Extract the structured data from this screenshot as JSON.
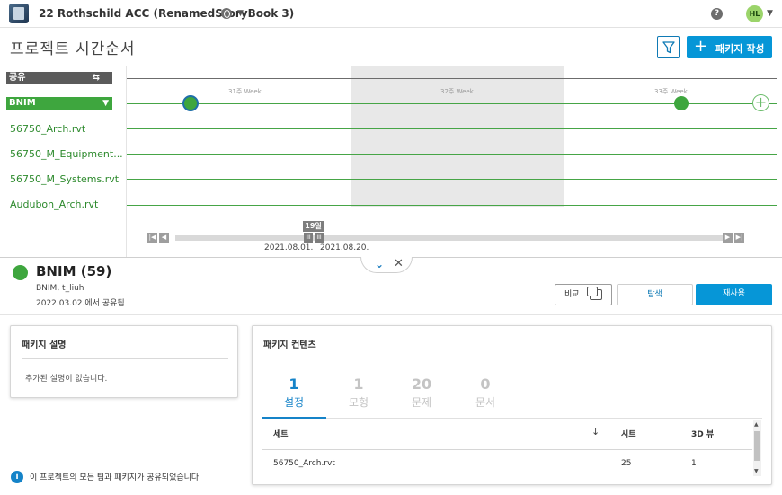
{
  "topbar": {
    "project_title": "22 Rothschild ACC (RenamedStoryBook 3)",
    "help_label": "?",
    "avatar_initials": "HL"
  },
  "header": {
    "page_title": "프로젝트 시간순서",
    "create_label": "패키지 작성",
    "create_plus": "+"
  },
  "sidebar": {
    "shared_label": "공유",
    "swap_glyph": "⇆",
    "group_label": "BNIM",
    "group_caret": "▼",
    "files": [
      "56750_Arch.rvt",
      "56750_M_Equipment...",
      "56750_M_Systems.rvt",
      "Audubon_Arch.rvt"
    ]
  },
  "timeline": {
    "weeks": [
      "31주 Week",
      "32주 Week",
      "33주 Week"
    ],
    "date_tag": "19일",
    "start_date": "2021.08.01.",
    "end_date": "2021.08.20.",
    "add_glyph": "+",
    "nav_first": "|◀",
    "nav_prev": "◀",
    "nav_next": "▶",
    "nav_last": "▶|",
    "handle_glyph": "III"
  },
  "package": {
    "name": "BNIM (59)",
    "owner": "BNIM, t_liuh",
    "shared_on": "2022.03.02.에서 공유됨",
    "compare_label": "비교",
    "explore_label": "탐색",
    "reuse_label": "재사용"
  },
  "description": {
    "title": "패키지 설명",
    "empty_text": "추가된 설명이 없습니다."
  },
  "info": {
    "icon_glyph": "i",
    "text": "이 프로젝트의 모든 팀과 패키지가 공유되었습니다."
  },
  "contents": {
    "title": "패키지 컨텐츠",
    "tabs": [
      {
        "num": "1",
        "label": "설정"
      },
      {
        "num": "1",
        "label": "모형"
      },
      {
        "num": "20",
        "label": "문제"
      },
      {
        "num": "0",
        "label": "문서"
      }
    ],
    "columns": [
      "세트",
      "시트",
      "3D 뷰"
    ],
    "sort_glyph": "↓",
    "rows": [
      {
        "set": "56750_Arch.rvt",
        "sheets": "25",
        "views3d": "1"
      }
    ]
  },
  "colors": {
    "accent": "#0696d7",
    "green": "#3ea63e",
    "link_green": "#2d8a2d"
  }
}
